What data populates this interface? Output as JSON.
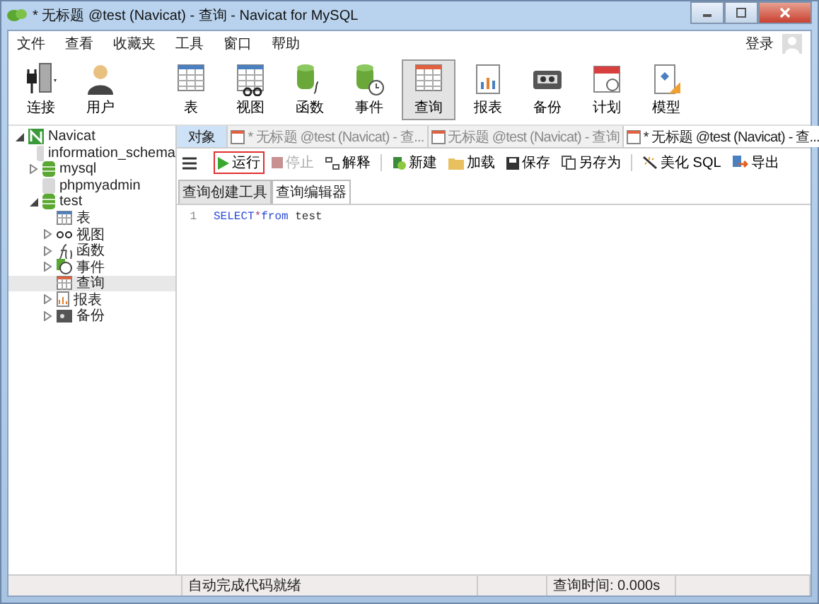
{
  "window": {
    "title": "* 无标题 @test (Navicat) - 查询 - Navicat for MySQL"
  },
  "menu": [
    "文件",
    "查看",
    "收藏夹",
    "工具",
    "窗口",
    "帮助"
  ],
  "login": "登录",
  "toolbar": [
    {
      "label": "连接",
      "selected": false
    },
    {
      "label": "用户",
      "selected": false
    },
    {
      "label": "表",
      "selected": false
    },
    {
      "label": "视图",
      "selected": false
    },
    {
      "label": "函数",
      "selected": false
    },
    {
      "label": "事件",
      "selected": false
    },
    {
      "label": "查询",
      "selected": true
    },
    {
      "label": "报表",
      "selected": false
    },
    {
      "label": "备份",
      "selected": false
    },
    {
      "label": "计划",
      "selected": false
    },
    {
      "label": "模型",
      "selected": false
    }
  ],
  "sidebar": {
    "items": [
      {
        "label": "Navicat",
        "kind": "connection",
        "expanded": true,
        "selected": false,
        "children": [
          {
            "label": "information_schema",
            "kind": "database",
            "selected": false
          },
          {
            "label": "mysql",
            "kind": "database-open",
            "expanded": false,
            "selected": false
          },
          {
            "label": "phpmyadmin",
            "kind": "database",
            "selected": false
          },
          {
            "label": "test",
            "kind": "database-open",
            "expanded": true,
            "selected": false,
            "children": [
              {
                "label": "表",
                "kind": "table",
                "selected": false
              },
              {
                "label": "视图",
                "kind": "view",
                "expanded": false,
                "selected": false
              },
              {
                "label": "函数",
                "kind": "function",
                "expanded": false,
                "selected": false
              },
              {
                "label": "事件",
                "kind": "event",
                "expanded": false,
                "selected": false
              },
              {
                "label": "查询",
                "kind": "query",
                "selected": true
              },
              {
                "label": "报表",
                "kind": "report",
                "expanded": false,
                "selected": false
              },
              {
                "label": "备份",
                "kind": "backup",
                "expanded": false,
                "selected": false
              }
            ]
          }
        ]
      }
    ]
  },
  "tabs": [
    {
      "label": "对象",
      "kind": "objects",
      "selected": false
    },
    {
      "label": "* 无标题 @test (Navicat) - 查...",
      "kind": "query",
      "selected": false
    },
    {
      "label": "无标题 @test (Navicat) - 查询",
      "kind": "query",
      "selected": false
    },
    {
      "label": "* 无标题 @test (Navicat) - 查...",
      "kind": "query",
      "selected": true
    }
  ],
  "query_toolbar": [
    {
      "label": "运行",
      "highlighted": true,
      "disabled": false
    },
    {
      "label": "停止",
      "highlighted": false,
      "disabled": true
    },
    {
      "label": "解释",
      "highlighted": false,
      "disabled": false
    },
    {
      "label": "新建",
      "highlighted": false,
      "disabled": false
    },
    {
      "label": "加载",
      "highlighted": false,
      "disabled": false
    },
    {
      "label": "保存",
      "highlighted": false,
      "disabled": false
    },
    {
      "label": "另存为",
      "highlighted": false,
      "disabled": false
    },
    {
      "label": "美化 SQL",
      "highlighted": false,
      "disabled": false
    },
    {
      "label": "导出",
      "highlighted": false,
      "disabled": false
    }
  ],
  "subtabs": [
    {
      "label": "查询创建工具",
      "selected": false
    },
    {
      "label": "查询编辑器",
      "selected": true
    }
  ],
  "editor": {
    "lines": [
      {
        "number": "1",
        "tokens": [
          {
            "text": "SELECT",
            "kind": "keyword"
          },
          {
            "text": "*",
            "kind": "operator"
          },
          {
            "text": "from",
            "kind": "keyword"
          },
          {
            "text": " test",
            "kind": "plain"
          }
        ]
      }
    ]
  },
  "status_bar": [
    "自动完成代码就绪",
    "查询时间: 0.000s"
  ]
}
